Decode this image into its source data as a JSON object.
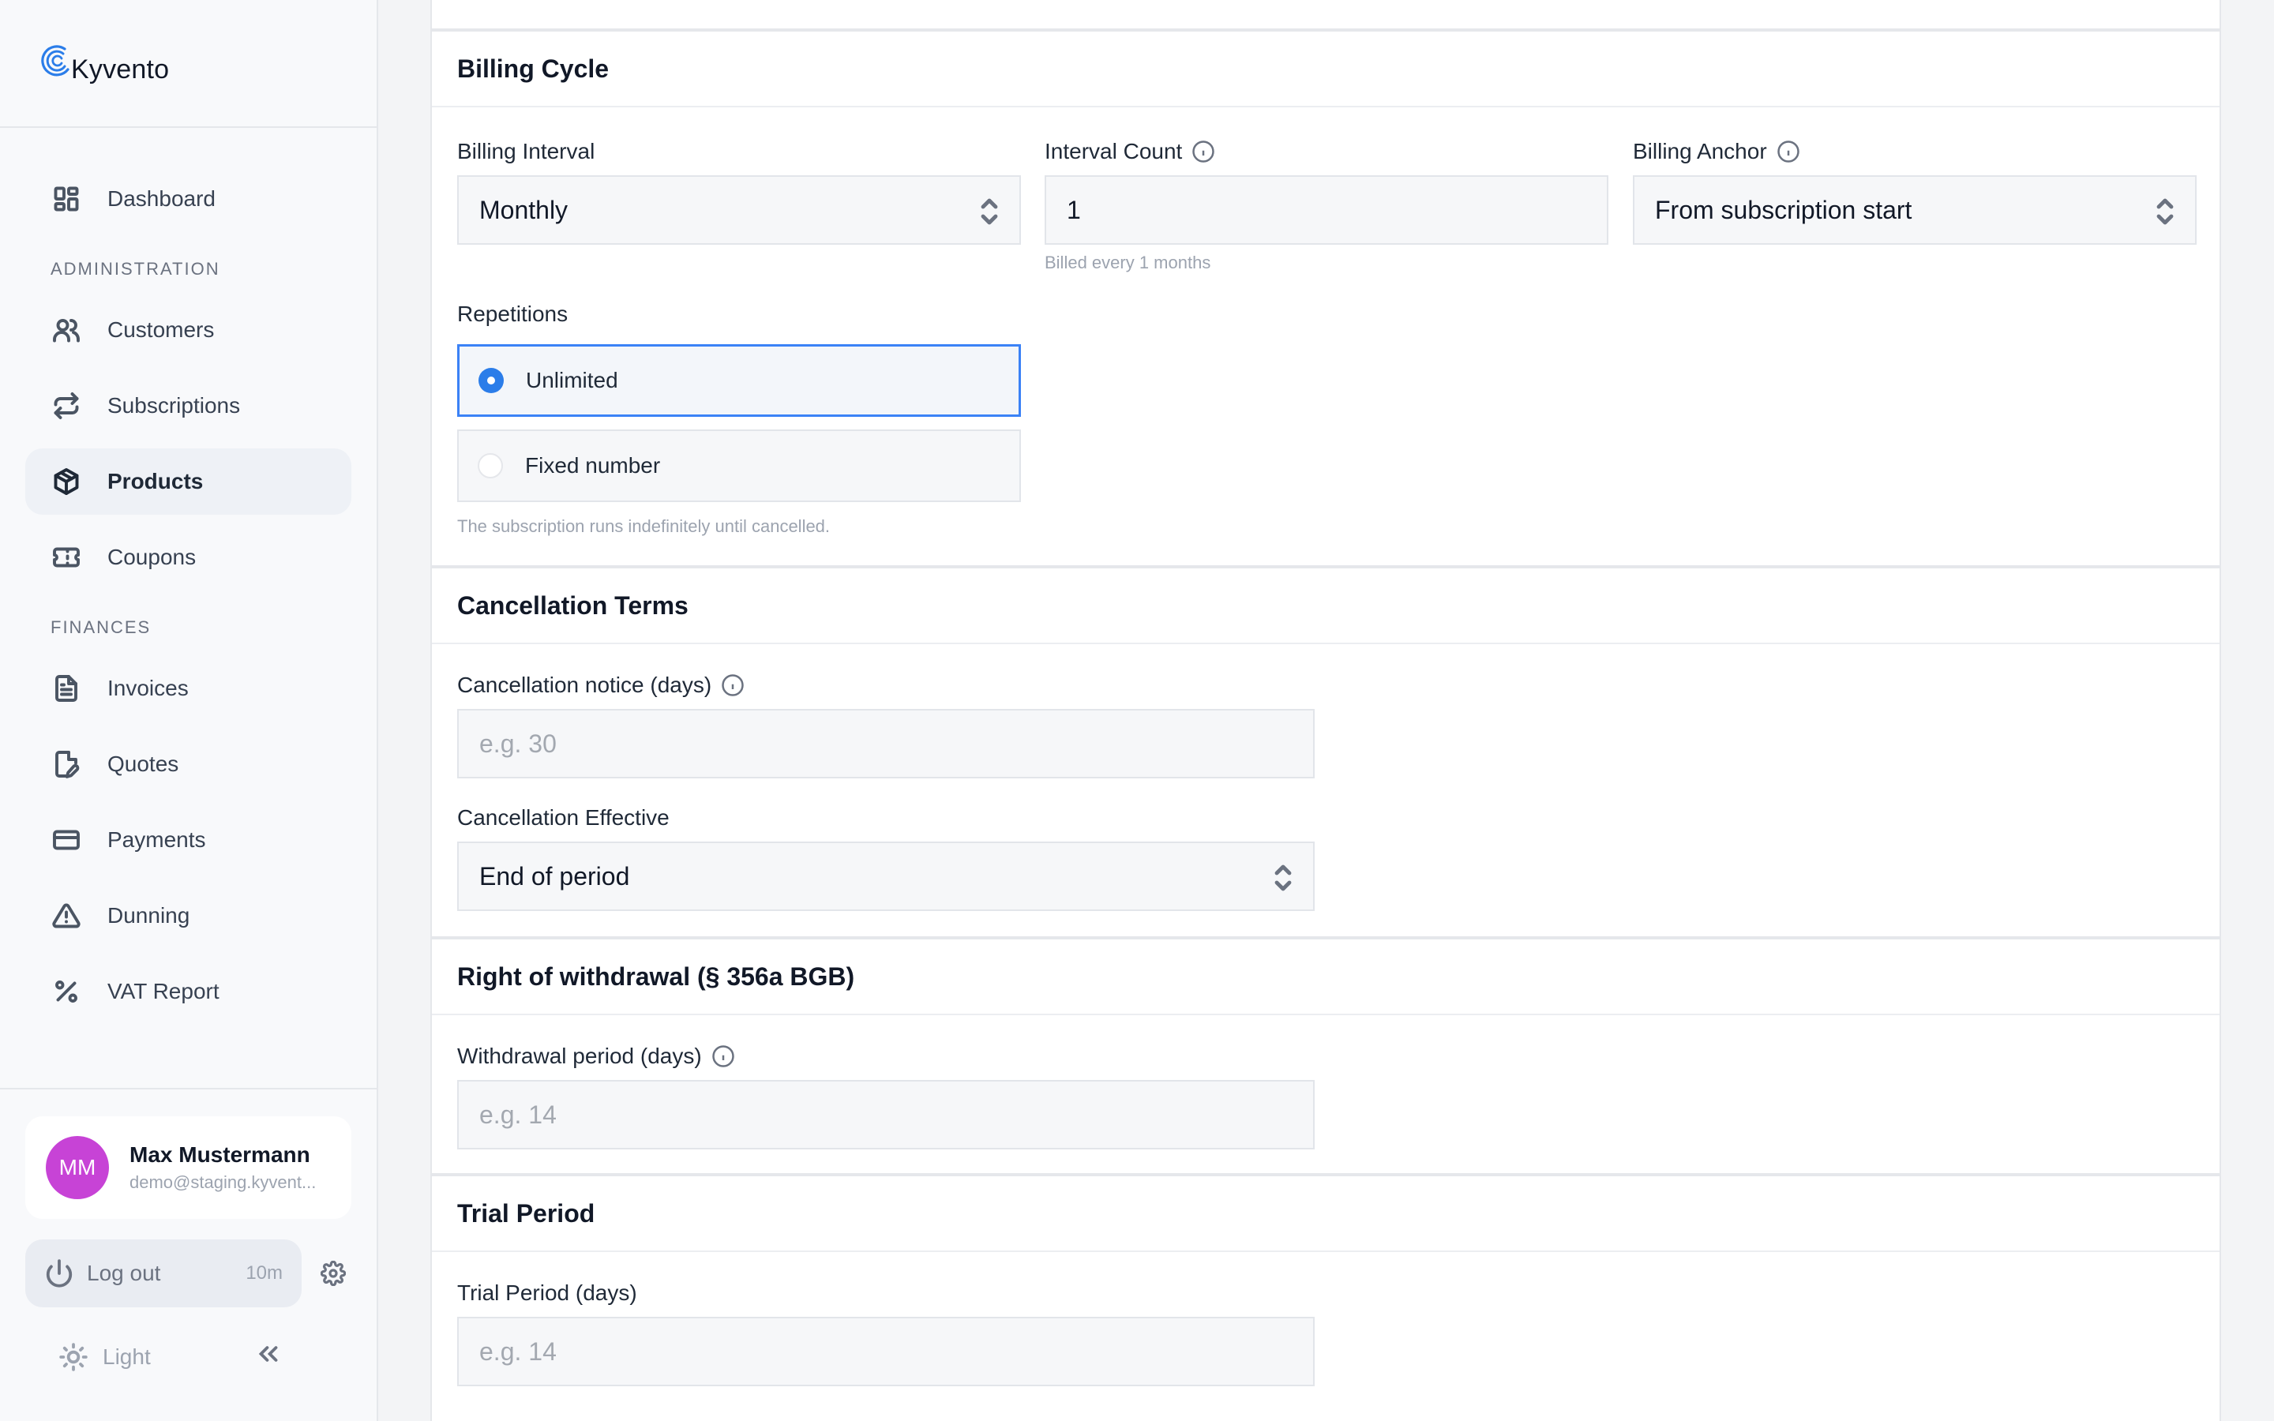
{
  "brand": {
    "name": "Kyvento"
  },
  "sidebar": {
    "dashboard": "Dashboard",
    "sections": [
      {
        "title": "ADMINISTRATION",
        "items": [
          {
            "label": "Customers",
            "icon": "users-icon"
          },
          {
            "label": "Subscriptions",
            "icon": "repeat-icon"
          },
          {
            "label": "Products",
            "icon": "package-icon",
            "active": true
          },
          {
            "label": "Coupons",
            "icon": "ticket-icon"
          }
        ]
      },
      {
        "title": "FINANCES",
        "items": [
          {
            "label": "Invoices",
            "icon": "file-text-icon"
          },
          {
            "label": "Quotes",
            "icon": "file-edit-icon"
          },
          {
            "label": "Payments",
            "icon": "credit-card-icon"
          },
          {
            "label": "Dunning",
            "icon": "alert-triangle-icon"
          },
          {
            "label": "VAT Report",
            "icon": "percent-icon"
          }
        ]
      }
    ],
    "user": {
      "initials": "MM",
      "name": "Max Mustermann",
      "email": "demo@staging.kyvent..."
    },
    "logout": {
      "label": "Log out",
      "time": "10m"
    },
    "theme": {
      "label": "Light"
    }
  },
  "billing_cycle": {
    "title": "Billing Cycle",
    "interval": {
      "label": "Billing Interval",
      "value": "Monthly"
    },
    "count": {
      "label": "Interval Count",
      "value": "1",
      "help": "Billed every 1 months"
    },
    "anchor": {
      "label": "Billing Anchor",
      "value": "From subscription start"
    },
    "repetitions": {
      "label": "Repetitions",
      "options": [
        "Unlimited",
        "Fixed number"
      ],
      "selected": "Unlimited",
      "help": "The subscription runs indefinitely until cancelled."
    }
  },
  "cancellation": {
    "title": "Cancellation Terms",
    "notice": {
      "label": "Cancellation notice (days)",
      "placeholder": "e.g. 30"
    },
    "effective": {
      "label": "Cancellation Effective",
      "value": "End of period"
    }
  },
  "withdrawal": {
    "title": "Right of withdrawal (§ 356a BGB)",
    "period": {
      "label": "Withdrawal period (days)",
      "placeholder": "e.g. 14"
    }
  },
  "trial": {
    "title": "Trial Period",
    "period": {
      "label": "Trial Period (days)",
      "placeholder": "e.g. 14"
    }
  },
  "colors": {
    "accent": "#2b7de9",
    "avatar": "#c743d6",
    "active_nav_bg": "#eef1f6"
  }
}
